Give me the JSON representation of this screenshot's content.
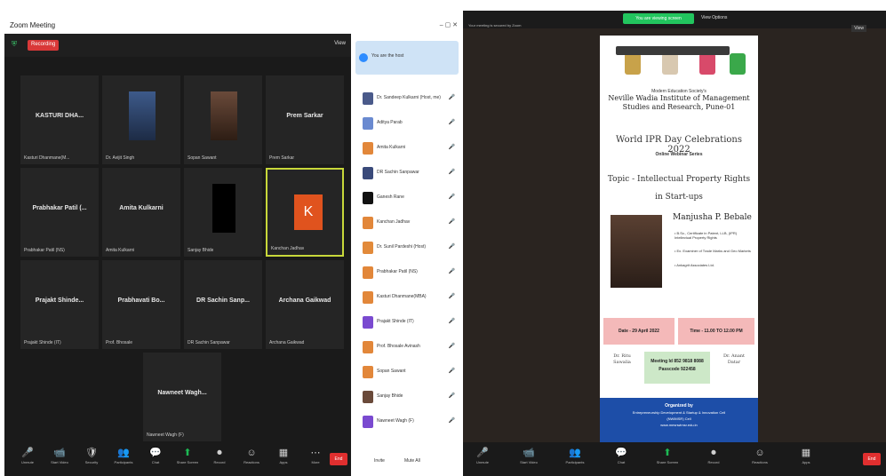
{
  "left_window": {
    "title": "Zoom Meeting",
    "recording_label": "Recording",
    "view_label": "View",
    "tiles": [
      {
        "name": "KASTURI DHA...",
        "caption": "Kasturi Dhanmane(M...",
        "type": "text"
      },
      {
        "name": "",
        "caption": "Dr. Avijit Singh",
        "type": "photo"
      },
      {
        "name": "",
        "caption": "Sopan Sawant",
        "type": "photo2"
      },
      {
        "name": "Prem Sarkar",
        "caption": "Prem Sarkar",
        "type": "text"
      },
      {
        "name": "Prabhakar Patil (...",
        "caption": "Prabhakar Patil (NS)",
        "type": "text"
      },
      {
        "name": "Amita Kulkarni",
        "caption": "Amita Kulkarni",
        "type": "text"
      },
      {
        "name": "",
        "caption": "Sanjay Bhide",
        "type": "black"
      },
      {
        "name": "K",
        "caption": "Kanchan Jadhav",
        "type": "avatar"
      },
      {
        "name": "Prajakt Shinde...",
        "caption": "Prajakt Shinde (IT)",
        "type": "text"
      },
      {
        "name": "Prabhavati Bo...",
        "caption": "Prof. Bhosale",
        "type": "text"
      },
      {
        "name": "DR Sachin Sanp...",
        "caption": "DR Sachin Sanpawar",
        "type": "text"
      },
      {
        "name": "Archana Gaikwad",
        "caption": "Archana Gaikwad",
        "type": "text"
      },
      {
        "name": "Nawneet Wagh...",
        "caption": "Nawneet Wagh (F)",
        "type": "text"
      }
    ],
    "toolbar": [
      {
        "icon": "🎤",
        "label": "Unmute"
      },
      {
        "icon": "📹",
        "label": "Start Video"
      },
      {
        "icon": "🛡",
        "label": "Security"
      },
      {
        "icon": "👥",
        "label": "Participants"
      },
      {
        "icon": "💬",
        "label": "Chat"
      },
      {
        "icon": "⬆",
        "label": "Share Screen"
      },
      {
        "icon": "⏺",
        "label": "Record"
      },
      {
        "icon": "☺",
        "label": "Reactions"
      },
      {
        "icon": "▦",
        "label": "Apps"
      },
      {
        "icon": "⋯",
        "label": "More"
      }
    ],
    "end_label": "End"
  },
  "participants_panel": {
    "notice_text": "You are the host",
    "participants": [
      {
        "name": "Dr. Sandeep Kulkarni (Host, me)",
        "color": "#4a5a8a"
      },
      {
        "name": "Aditya Parab",
        "color": "#6a8ad0"
      },
      {
        "name": "Amita Kulkarni",
        "color": "#e2873a"
      },
      {
        "name": "DR Sachin Sanpawar",
        "color": "#3a4a7a"
      },
      {
        "name": "Ganesh Rane",
        "color": "#111111"
      },
      {
        "name": "Kanchan Jadhav",
        "color": "#e2873a"
      },
      {
        "name": "Dr. Sunil Pardeshi (Host)",
        "color": "#e28a3a"
      },
      {
        "name": "Prabhakar Patil (NS)",
        "color": "#e2873a"
      },
      {
        "name": "Kasturi Dhanmane(MBA)",
        "color": "#e2873a"
      },
      {
        "name": "Prajakt Shinde (IT)",
        "color": "#7a4ad0"
      },
      {
        "name": "Prof. Bhosale Avinash",
        "color": "#e2873a"
      },
      {
        "name": "Sopan Sawant",
        "color": "#e2873a"
      },
      {
        "name": "Sanjay Bhide",
        "color": "#6a4a3a"
      },
      {
        "name": "Nawneet Wagh (F)",
        "color": "#7a4ad0"
      }
    ],
    "invite_label": "Invite",
    "mute_all_label": "Mute All"
  },
  "right_window": {
    "viewing_label": "You are viewing screen",
    "view_options_label": "View Options",
    "security_label": "Your meeting is secured by Zoom",
    "view_label": "View",
    "toolbar": [
      {
        "icon": "🎤",
        "label": "Unmute"
      },
      {
        "icon": "📹",
        "label": "Start Video"
      },
      {
        "icon": "👥",
        "label": "Participants"
      },
      {
        "icon": "💬",
        "label": "Chat"
      },
      {
        "icon": "⬆",
        "label": "Share Screen"
      },
      {
        "icon": "⏺",
        "label": "Record"
      },
      {
        "icon": "☺",
        "label": "Reactions"
      },
      {
        "icon": "▦",
        "label": "Apps"
      }
    ],
    "end_label": "End"
  },
  "poster": {
    "society": "Modern Education Society's",
    "institute": "Neville Wadia Institute of Management Studies and Research, Pune-01",
    "event": "World IPR Day Celebrations 2022",
    "series": "Online Webinar Series",
    "topic": "Topic - Intellectual Property Rights in Start-ups",
    "speaker": "Manjusha P. Bebale",
    "bullets": [
      "• B.Sc., Certificate in Patent, LLB, (IPR) Intellectual Property Rights",
      "• Ex. Examiner of Trade Marks and Geo Markets",
      "• Ankagrit Associates Ltd."
    ],
    "date": "Date - 29 April 2022",
    "time": "Time - 11.00 TO 12.00 PM",
    "coordinator_left": "Dr. Ritu Sawalia",
    "coordinator_right": "Dr. Anant Datar",
    "meeting_id": "Meeting Id 852 9818 8088",
    "passcode": "Passcode 922458",
    "organized_by": "Organized by",
    "organizer": "Entrepreneurship Development & Startup & Innovation Cell",
    "organizer2": "(NWIMSR) Cell",
    "website": "www.mesnwimsr.edu.in"
  }
}
